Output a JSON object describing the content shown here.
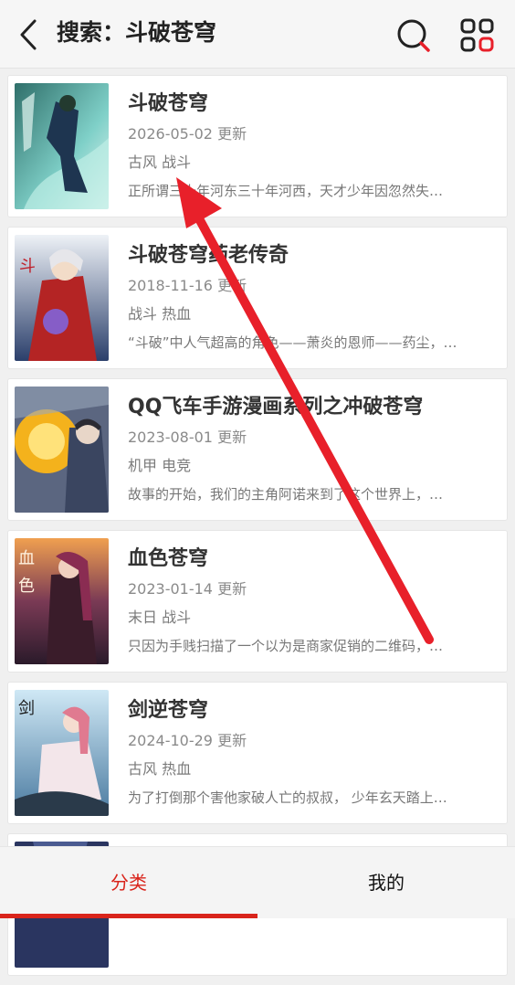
{
  "header": {
    "title": "搜索：斗破苍穹",
    "back_icon": "chevron-left-icon",
    "search_icon": "search-icon",
    "menu_icon": "grid-icon"
  },
  "results": [
    {
      "title": "斗破苍穹",
      "date": "2026-05-02 更新",
      "tags": "古风 战斗",
      "desc": "正所谓三十年河东三十年河西，天才少年因忽然失…"
    },
    {
      "title": "斗破苍穹药老传奇",
      "date": "2018-11-16 更新",
      "tags": "战斗 热血",
      "desc": "“斗破”中人气超高的角色——萧炎的恩师——药尘，…"
    },
    {
      "title": "QQ飞车手游漫画系列之冲破苍穹",
      "date": "2023-08-01 更新",
      "tags": "机甲 电竞",
      "desc": "故事的开始，我们的主角阿诺来到了这个世界上，…"
    },
    {
      "title": "血色苍穹",
      "date": "2023-01-14 更新",
      "tags": "末日 战斗",
      "desc": "只因为手贱扫描了一个以为是商家促销的二维码，…"
    },
    {
      "title": "剑逆苍穹",
      "date": "2024-10-29 更新",
      "tags": "古风 热血",
      "desc": "为了打倒那个害他家破人亡的叔叔， 少年玄天踏上…"
    },
    {
      "title": "",
      "date": "",
      "tags": "",
      "desc": ""
    }
  ],
  "bottom_nav": {
    "tabs": [
      {
        "label": "分类",
        "active": true
      },
      {
        "label": "我的",
        "active": false
      }
    ]
  },
  "colors": {
    "accent": "#d9241b",
    "annotation_arrow": "#e8202a"
  }
}
